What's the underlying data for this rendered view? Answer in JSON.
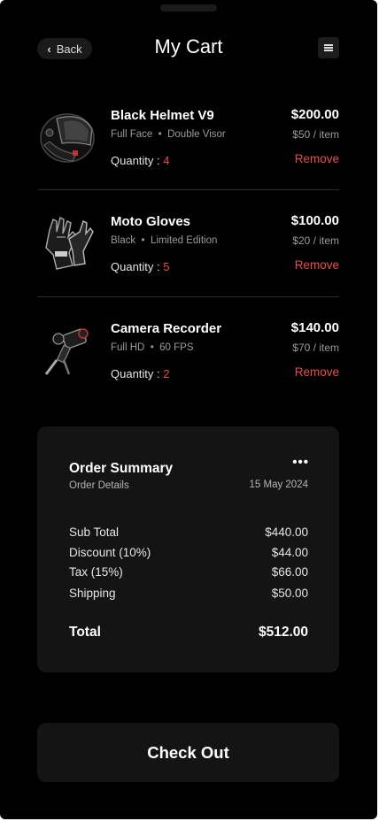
{
  "header": {
    "back_label": "Back",
    "title": "My Cart"
  },
  "items": [
    {
      "name": "Black Helmet V9",
      "tag1": "Full Face",
      "tag2": "Double Visor",
      "qty_label": "Quantity :",
      "qty": "4",
      "price": "$200.00",
      "unit_price": "$50 / item",
      "remove_label": "Remove",
      "icon": "helmet-icon"
    },
    {
      "name": "Moto Gloves",
      "tag1": "Black",
      "tag2": "Limited Edition",
      "qty_label": "Quantity :",
      "qty": "5",
      "price": "$100.00",
      "unit_price": "$20 / item",
      "remove_label": "Remove",
      "icon": "gloves-icon"
    },
    {
      "name": "Camera Recorder",
      "tag1": "Full HD",
      "tag2": "60 FPS",
      "qty_label": "Quantity :",
      "qty": "2",
      "price": "$140.00",
      "unit_price": "$70 / item",
      "remove_label": "Remove",
      "icon": "camera-icon"
    }
  ],
  "summary": {
    "title": "Order Summary",
    "subtitle": "Order Details",
    "more": "•••",
    "date": "15 May 2024",
    "rows": [
      {
        "label": "Sub Total",
        "value": "$440.00"
      },
      {
        "label": "Discount (10%)",
        "value": "$44.00"
      },
      {
        "label": "Tax (15%)",
        "value": "$66.00"
      },
      {
        "label": "Shipping",
        "value": "$50.00"
      }
    ],
    "total_label": "Total",
    "total_value": "$512.00"
  },
  "checkout_label": "Check Out",
  "colors": {
    "background": "#000000",
    "card": "#141414",
    "accent_red": "#e74c4c",
    "muted": "#9a9a9a"
  }
}
